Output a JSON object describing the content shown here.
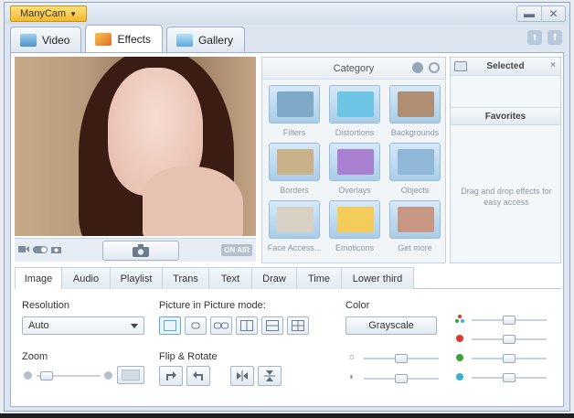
{
  "app": {
    "menu_label": "ManyCam",
    "window_buttons": [
      "minimize",
      "close"
    ]
  },
  "main_tabs": [
    {
      "label": "Video",
      "icon": "video-tab-icon",
      "active": false
    },
    {
      "label": "Effects",
      "icon": "effects-tab-icon",
      "active": true
    },
    {
      "label": "Gallery",
      "icon": "gallery-tab-icon",
      "active": false
    }
  ],
  "social": {
    "twitter": "t",
    "facebook": "f"
  },
  "video": {
    "on_air": "ON AIR"
  },
  "category": {
    "title": "Category",
    "items": [
      {
        "label": "Filters",
        "thumb": "#7fa9c8"
      },
      {
        "label": "Distortions",
        "thumb": "#6ec4e4"
      },
      {
        "label": "Backgrounds",
        "thumb": "#b08e74"
      },
      {
        "label": "Borders",
        "thumb": "#c9b28a"
      },
      {
        "label": "Overlays",
        "thumb": "#a97fd0"
      },
      {
        "label": "Objects",
        "thumb": "#8fb8d8"
      },
      {
        "label": "Face Access...",
        "thumb": "#d7d0c3"
      },
      {
        "label": "Emoticons",
        "thumb": "#f3cc5a"
      },
      {
        "label": "Get more",
        "thumb": "#c79784"
      }
    ]
  },
  "selected": {
    "title": "Selected",
    "favorites_title": "Favorites",
    "hint": "Drag and drop effects for easy access"
  },
  "bottom_tabs": [
    {
      "label": "Image",
      "active": true
    },
    {
      "label": "Audio",
      "active": false
    },
    {
      "label": "Playlist",
      "active": false
    },
    {
      "label": "Trans",
      "active": false
    },
    {
      "label": "Text",
      "active": false
    },
    {
      "label": "Draw",
      "active": false
    },
    {
      "label": "Time",
      "active": false
    },
    {
      "label": "Lower third",
      "active": false
    }
  ],
  "image_panel": {
    "resolution_label": "Resolution",
    "resolution_value": "Auto",
    "pip_label": "Picture in Picture mode:",
    "zoom_label": "Zoom",
    "flip_label": "Flip & Rotate",
    "color_label": "Color",
    "grayscale_label": "Grayscale",
    "rgb_colors": {
      "red": "#e0352b",
      "green": "#3aa33a",
      "blue": "#3bb0cf"
    }
  },
  "colors": {
    "accent": "#f3b92f",
    "window_bg": "#dde6f0"
  }
}
